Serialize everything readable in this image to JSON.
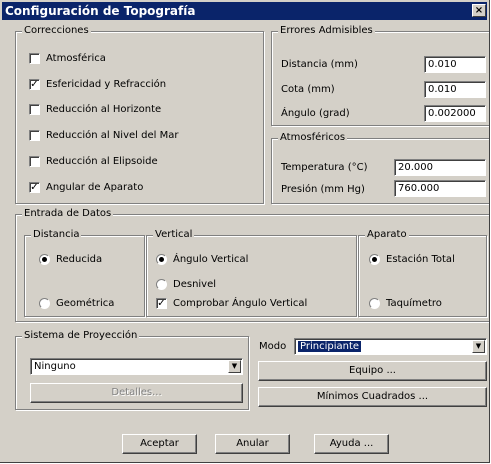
{
  "window": {
    "title": "Configuración de Topografía"
  },
  "correcciones": {
    "title": "Correcciones",
    "items": [
      {
        "label": "Atmosférica",
        "checked": false
      },
      {
        "label": "Esfericidad y Refracción",
        "checked": true
      },
      {
        "label": "Reducción al Horizonte",
        "checked": false
      },
      {
        "label": "Reducción al Nivel del Mar",
        "checked": false
      },
      {
        "label": "Reducción al Elipsoide",
        "checked": false
      },
      {
        "label": "Angular de Aparato",
        "checked": true
      }
    ]
  },
  "errores": {
    "title": "Errores Admisibles",
    "fields": [
      {
        "label": "Distancia (mm)",
        "value": "0.010"
      },
      {
        "label": "Cota (mm)",
        "value": "0.010"
      },
      {
        "label": "Ángulo (grad)",
        "value": "0.002000"
      }
    ]
  },
  "atmosfericos": {
    "title": "Atmosféricos",
    "fields": [
      {
        "label": "Temperatura (°C)",
        "value": "20.000"
      },
      {
        "label": "Presión (mm Hg)",
        "value": "760.000"
      }
    ]
  },
  "entrada": {
    "title": "Entrada de Datos",
    "distancia": {
      "title": "Distancia",
      "options": [
        "Reducida",
        "Geométrica"
      ],
      "selected": "Reducida"
    },
    "vertical": {
      "title": "Vertical",
      "options": [
        "Ángulo Vertical",
        "Desnivel"
      ],
      "selected": "Ángulo Vertical",
      "comprobar": {
        "label": "Comprobar Ángulo Vertical",
        "checked": true
      }
    },
    "aparato": {
      "title": "Aparato",
      "options": [
        "Estación Total",
        "Taquímetro"
      ],
      "selected": "Estación Total"
    }
  },
  "proyeccion": {
    "title": "Sistema de Proyección",
    "value": "Ninguno",
    "detalles_label": "Detalles..."
  },
  "modo": {
    "label": "Modo",
    "value": "Principiante"
  },
  "buttons": {
    "equipo": "Equipo ...",
    "minimos": "Mínimos Cuadrados ...",
    "aceptar": "Aceptar",
    "anular": "Anular",
    "ayuda": "Ayuda ..."
  },
  "colors": {
    "title_bar": "#0a246a",
    "face": "#d4d0c8"
  }
}
